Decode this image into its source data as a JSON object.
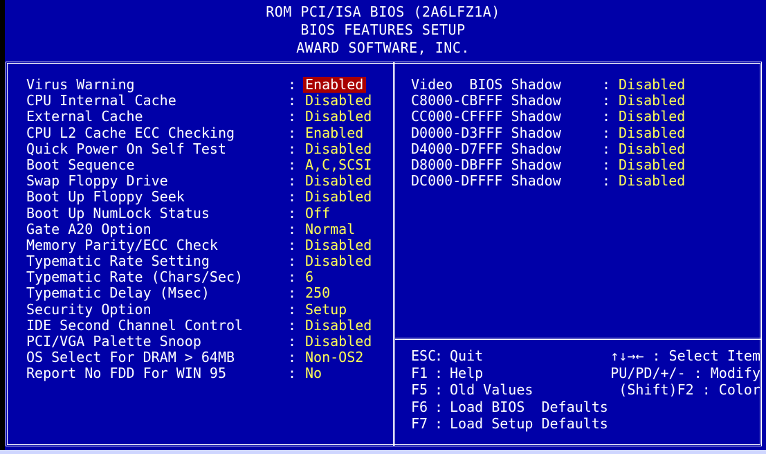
{
  "header": {
    "line1": "ROM PCI/ISA BIOS (2A6LFZ1A)",
    "line2": "BIOS FEATURES SETUP",
    "line3": "AWARD SOFTWARE, INC."
  },
  "colors": {
    "background": "#0000a8",
    "text": "#ffffff",
    "value": "#ffff55",
    "selected_bg": "#a80000"
  },
  "settings": [
    {
      "label": "Virus Warning",
      "value": "Enabled",
      "selected": true
    },
    {
      "label": "CPU Internal Cache",
      "value": "Disabled"
    },
    {
      "label": "External Cache",
      "value": "Disabled"
    },
    {
      "label": "CPU L2 Cache ECC Checking",
      "value": "Enabled"
    },
    {
      "label": "Quick Power On Self Test",
      "value": "Disabled"
    },
    {
      "label": "Boot Sequence",
      "value": "A,C,SCSI"
    },
    {
      "label": "Swap Floppy Drive",
      "value": "Disabled"
    },
    {
      "label": "Boot Up Floppy Seek",
      "value": "Disabled"
    },
    {
      "label": "Boot Up NumLock Status",
      "value": "Off"
    },
    {
      "label": "Gate A20 Option",
      "value": "Normal"
    },
    {
      "label": "Memory Parity/ECC Check",
      "value": "Disabled"
    },
    {
      "label": "Typematic Rate Setting",
      "value": "Disabled"
    },
    {
      "label": "Typematic Rate (Chars/Sec)",
      "value": "6"
    },
    {
      "label": "Typematic Delay (Msec)",
      "value": "250"
    },
    {
      "label": "Security Option",
      "value": "Setup"
    },
    {
      "label": "IDE Second Channel Control",
      "value": "Disabled"
    },
    {
      "label": "PCI/VGA Palette Snoop",
      "value": "Disabled"
    },
    {
      "label": "OS Select For DRAM > 64MB",
      "value": "Non-OS2"
    },
    {
      "label": "Report No FDD For WIN 95",
      "value": "No"
    }
  ],
  "shadows": [
    {
      "label": "Video  BIOS Shadow",
      "value": "Disabled"
    },
    {
      "label": "C8000-CBFFF Shadow",
      "value": "Disabled"
    },
    {
      "label": "CC000-CFFFF Shadow",
      "value": "Disabled"
    },
    {
      "label": "D0000-D3FFF Shadow",
      "value": "Disabled"
    },
    {
      "label": "D4000-D7FFF Shadow",
      "value": "Disabled"
    },
    {
      "label": "D8000-DBFFF Shadow",
      "value": "Disabled"
    },
    {
      "label": "DC000-DFFFF Shadow",
      "value": "Disabled"
    }
  ],
  "help": {
    "esc": {
      "key": "ESC",
      "desc": "Quit",
      "right": "↑↓→← : Select Item"
    },
    "f1": {
      "key": "F1",
      "desc": "Help",
      "right": "PU/PD/+/- : Modify"
    },
    "f5": {
      "key": "F5",
      "desc": "Old Values",
      "right": "(Shift)F2 : Color"
    },
    "f6": {
      "key": "F6",
      "desc": "Load BIOS  Defaults"
    },
    "f7": {
      "key": "F7",
      "desc": "Load Setup Defaults"
    }
  },
  "separator": ":"
}
